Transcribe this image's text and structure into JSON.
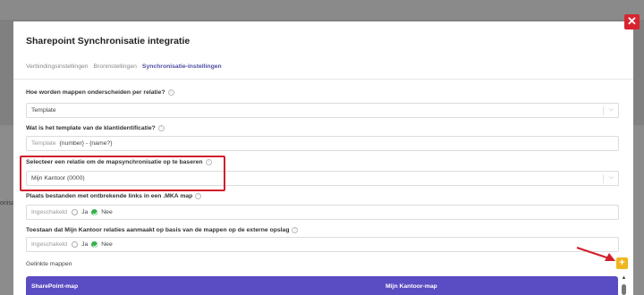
{
  "background": {
    "left_text": "onisatie"
  },
  "modal": {
    "title": "Sharepoint Synchronisatie integratie",
    "close_label": "✕",
    "tabs": [
      {
        "label": "Verbindingsinstellingen",
        "active": false
      },
      {
        "label": "Broninstellingen",
        "active": false
      },
      {
        "label": "Synchronisatie-instellingen",
        "active": true
      }
    ],
    "fields": {
      "separation": {
        "label": "Hoe worden mappen onderscheiden per relatie?",
        "value": "Template"
      },
      "template": {
        "label": "Wat is het template van de klantidentificatie?",
        "prefix": "Template",
        "value": "{number} - {name?}"
      },
      "relation": {
        "label": "Selecteer een relatie om de mapsynchronisatie op te baseren",
        "value": "Mijn Kantoor (0000)"
      },
      "broken_links": {
        "label": "Plaats bestanden met ontbrekende links in een .MKA map",
        "prefix": "Ingeschakeld",
        "options": [
          "Ja",
          "Nee"
        ],
        "selected": "Nee"
      },
      "allow_relations": {
        "label": "Toestaan dat Mijn Kantoor relaties aanmaakt op basis van de mappen op de externe opslag",
        "prefix": "Ingeschakeld",
        "options": [
          "Ja",
          "Nee"
        ],
        "selected": "Nee"
      }
    },
    "linked_folders": {
      "label": "Gelinkte mappen",
      "add_label": "+",
      "columns": [
        "SharePoint-map",
        "Mijn Kantoor-map"
      ]
    }
  },
  "colors": {
    "accent": "#5a4cc2",
    "close": "#d9242f",
    "highlight": "#d21e2a",
    "add": "#f0b51e",
    "check": "#35b04a"
  }
}
